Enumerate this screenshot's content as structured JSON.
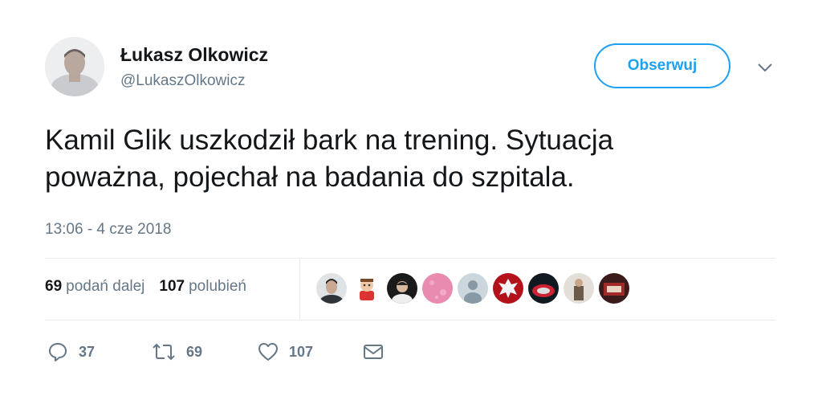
{
  "user": {
    "name": "Łukasz Olkowicz",
    "handle": "@LukaszOlkowicz"
  },
  "follow_label": "Obserwuj",
  "tweet": {
    "line1": "Kamil Glik uszkodził bark na trening. Sytuacja",
    "line2": "poważna, pojechał na badania do szpitala.",
    "timestamp": "13:06 - 4 cze 2018"
  },
  "stats": {
    "retweets_count": "69",
    "retweets_label": "podań dalej",
    "likes_count": "107",
    "likes_label": "polubień"
  },
  "actions": {
    "reply_count": "37",
    "retweet_count": "69",
    "like_count": "107"
  },
  "colors": {
    "accent": "#1da1f2",
    "muted": "#657786",
    "text": "#14171a",
    "divider": "#e6ecf0"
  }
}
